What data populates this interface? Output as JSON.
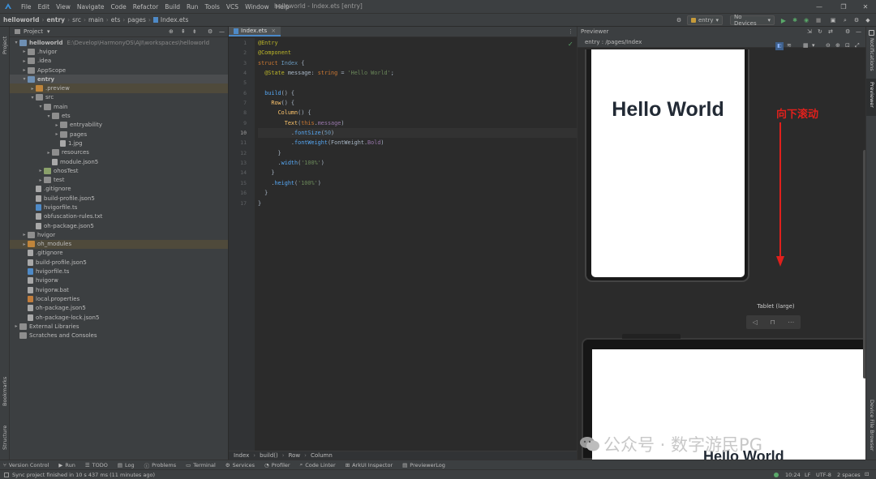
{
  "window": {
    "title": "helloworld - Index.ets [entry]"
  },
  "menu": [
    "File",
    "Edit",
    "View",
    "Navigate",
    "Code",
    "Refactor",
    "Build",
    "Run",
    "Tools",
    "VCS",
    "Window",
    "Help"
  ],
  "breadcrumb": [
    "helloworld",
    "entry",
    "src",
    "main",
    "ets",
    "pages",
    "Index.ets"
  ],
  "toolbar": {
    "module_select": "entry",
    "device_select": "No Devices"
  },
  "project_panel": {
    "title": "Project",
    "tree": [
      {
        "indent": 0,
        "arrow": "v",
        "icon": "fold b",
        "label": "helloworld",
        "extra": "E:\\Develop\\HarmonyOS\\AJI\\workspaces\\helloworld",
        "bold": true
      },
      {
        "indent": 1,
        "arrow": ">",
        "icon": "fold",
        "label": ".hvigor"
      },
      {
        "indent": 1,
        "arrow": ">",
        "icon": "fold",
        "label": ".idea"
      },
      {
        "indent": 1,
        "arrow": ">",
        "icon": "fold",
        "label": "AppScope"
      },
      {
        "indent": 1,
        "arrow": "v",
        "icon": "fold b",
        "label": "entry",
        "bold": true
      },
      {
        "indent": 2,
        "arrow": ">",
        "icon": "fold o",
        "label": ".preview",
        "state": "mod"
      },
      {
        "indent": 2,
        "arrow": "v",
        "icon": "fold",
        "label": "src"
      },
      {
        "indent": 3,
        "arrow": "v",
        "icon": "fold",
        "label": "main"
      },
      {
        "indent": 4,
        "arrow": "v",
        "icon": "fold",
        "label": "ets"
      },
      {
        "indent": 5,
        "arrow": ">",
        "icon": "fold",
        "label": "entryability"
      },
      {
        "indent": 5,
        "arrow": ">",
        "icon": "fold",
        "label": "pages"
      },
      {
        "indent": 5,
        "arrow": "",
        "icon": "file g",
        "label": "1.jpg"
      },
      {
        "indent": 4,
        "arrow": ">",
        "icon": "fold",
        "label": "resources"
      },
      {
        "indent": 4,
        "arrow": "",
        "icon": "file",
        "label": "module.json5"
      },
      {
        "indent": 3,
        "arrow": ">",
        "icon": "fold g",
        "label": "ohosTest"
      },
      {
        "indent": 3,
        "arrow": ">",
        "icon": "fold",
        "label": "test"
      },
      {
        "indent": 2,
        "arrow": "",
        "icon": "file",
        "label": ".gitignore"
      },
      {
        "indent": 2,
        "arrow": "",
        "icon": "file",
        "label": "build-profile.json5"
      },
      {
        "indent": 2,
        "arrow": "",
        "icon": "file b",
        "label": "hvigorfile.ts"
      },
      {
        "indent": 2,
        "arrow": "",
        "icon": "file",
        "label": "obfuscation-rules.txt"
      },
      {
        "indent": 2,
        "arrow": "",
        "icon": "file",
        "label": "oh-package.json5"
      },
      {
        "indent": 1,
        "arrow": ">",
        "icon": "fold",
        "label": "hvigor"
      },
      {
        "indent": 1,
        "arrow": ">",
        "icon": "fold o",
        "label": "oh_modules",
        "state": "mod"
      },
      {
        "indent": 1,
        "arrow": "",
        "icon": "file",
        "label": ".gitignore"
      },
      {
        "indent": 1,
        "arrow": "",
        "icon": "file",
        "label": "build-profile.json5"
      },
      {
        "indent": 1,
        "arrow": "",
        "icon": "file b",
        "label": "hvigorfile.ts"
      },
      {
        "indent": 1,
        "arrow": "",
        "icon": "file",
        "label": "hvigorw"
      },
      {
        "indent": 1,
        "arrow": "",
        "icon": "file",
        "label": "hvigorw.bat"
      },
      {
        "indent": 1,
        "arrow": "",
        "icon": "file o",
        "label": "local.properties"
      },
      {
        "indent": 1,
        "arrow": "",
        "icon": "file",
        "label": "oh-package.json5"
      },
      {
        "indent": 1,
        "arrow": "",
        "icon": "file",
        "label": "oh-package-lock.json5"
      },
      {
        "indent": 0,
        "arrow": ">",
        "icon": "fold",
        "label": "External Libraries"
      },
      {
        "indent": 0,
        "arrow": "",
        "icon": "fold",
        "label": "Scratches and Consoles"
      }
    ]
  },
  "editor": {
    "tab": "Index.ets",
    "lines": [
      "1",
      "2",
      "3",
      "4",
      "5",
      "6",
      "7",
      "8",
      "9",
      "10",
      "11",
      "12",
      "13",
      "14",
      "15",
      "16",
      "17"
    ],
    "code": [
      [
        [
          "dec",
          "@Entry"
        ]
      ],
      [
        [
          "dec",
          "@Component"
        ]
      ],
      [
        [
          "kw",
          "struct "
        ],
        [
          "cls",
          "Index "
        ],
        [
          "plain",
          "{"
        ]
      ],
      [
        [
          "plain",
          "  "
        ],
        [
          "dec",
          "@State "
        ],
        [
          "plain",
          "message: "
        ],
        [
          "kw",
          "string "
        ],
        [
          "plain",
          "= "
        ],
        [
          "str",
          "'Hello World'"
        ],
        [
          "plain",
          ";"
        ]
      ],
      [],
      [
        [
          "plain",
          "  "
        ],
        [
          "meth",
          "build"
        ],
        [
          "plain",
          "() {"
        ]
      ],
      [
        [
          "plain",
          "    "
        ],
        [
          "fn",
          "Row"
        ],
        [
          "plain",
          "() {"
        ]
      ],
      [
        [
          "plain",
          "      "
        ],
        [
          "fn",
          "Column"
        ],
        [
          "plain",
          "() {"
        ]
      ],
      [
        [
          "plain",
          "        "
        ],
        [
          "fn",
          "Text"
        ],
        [
          "plain",
          "("
        ],
        [
          "this",
          "this"
        ],
        [
          "plain",
          "."
        ],
        [
          "prop",
          "message"
        ],
        [
          "plain",
          ")"
        ]
      ],
      [
        [
          "plain",
          "          ."
        ],
        [
          "meth",
          "fontSize"
        ],
        [
          "plain",
          "("
        ],
        [
          "num",
          "50"
        ],
        [
          "plain",
          ")"
        ]
      ],
      [
        [
          "plain",
          "          ."
        ],
        [
          "meth",
          "fontWeight"
        ],
        [
          "plain",
          "(FontWeight."
        ],
        [
          "prop",
          "Bold"
        ],
        [
          "plain",
          ")"
        ]
      ],
      [
        [
          "plain",
          "      }"
        ]
      ],
      [
        [
          "plain",
          "      ."
        ],
        [
          "meth",
          "width"
        ],
        [
          "plain",
          "("
        ],
        [
          "str",
          "'100%'"
        ],
        [
          "plain",
          ")"
        ]
      ],
      [
        [
          "plain",
          "    }"
        ]
      ],
      [
        [
          "plain",
          "    ."
        ],
        [
          "meth",
          "height"
        ],
        [
          "plain",
          "("
        ],
        [
          "str",
          "'100%'"
        ],
        [
          "plain",
          ")"
        ]
      ],
      [
        [
          "plain",
          "  }"
        ]
      ],
      [
        [
          "plain",
          "}"
        ]
      ]
    ],
    "breadcrumb": [
      "Index",
      "build()",
      "Row",
      "Column"
    ]
  },
  "previewer": {
    "title": "Previewer",
    "path": "entry : /pages/Index",
    "phone_text": "Hello World",
    "annotation": "向下滚动",
    "device2_label": "Tablet (large)",
    "tablet_text": "Hello World",
    "watermark": "公众号 · 数字游民PG"
  },
  "side_labels": {
    "left_top": "Project",
    "left_bottom1": "Bookmarks",
    "left_bottom2": "Structure",
    "right_top1": "Notifications",
    "right_top2": "Previewer",
    "right_bottom": "Device File Browser"
  },
  "bottom_tools": [
    "Version Control",
    "Run",
    "TODO",
    "Log",
    "Problems",
    "Terminal",
    "Services",
    "Profiler",
    "Code Linter",
    "ArkUI Inspector",
    "PreviewerLog"
  ],
  "status": {
    "message": "Sync project finished in 10 s 437 ms (11 minutes ago)",
    "position": "10:24",
    "line_sep": "LF",
    "encoding": "UTF-8",
    "indent": "2 spaces"
  },
  "colors": {
    "accent": "#4a88c7",
    "arrow_red": "#e0201c",
    "run_green": "#59a869"
  }
}
